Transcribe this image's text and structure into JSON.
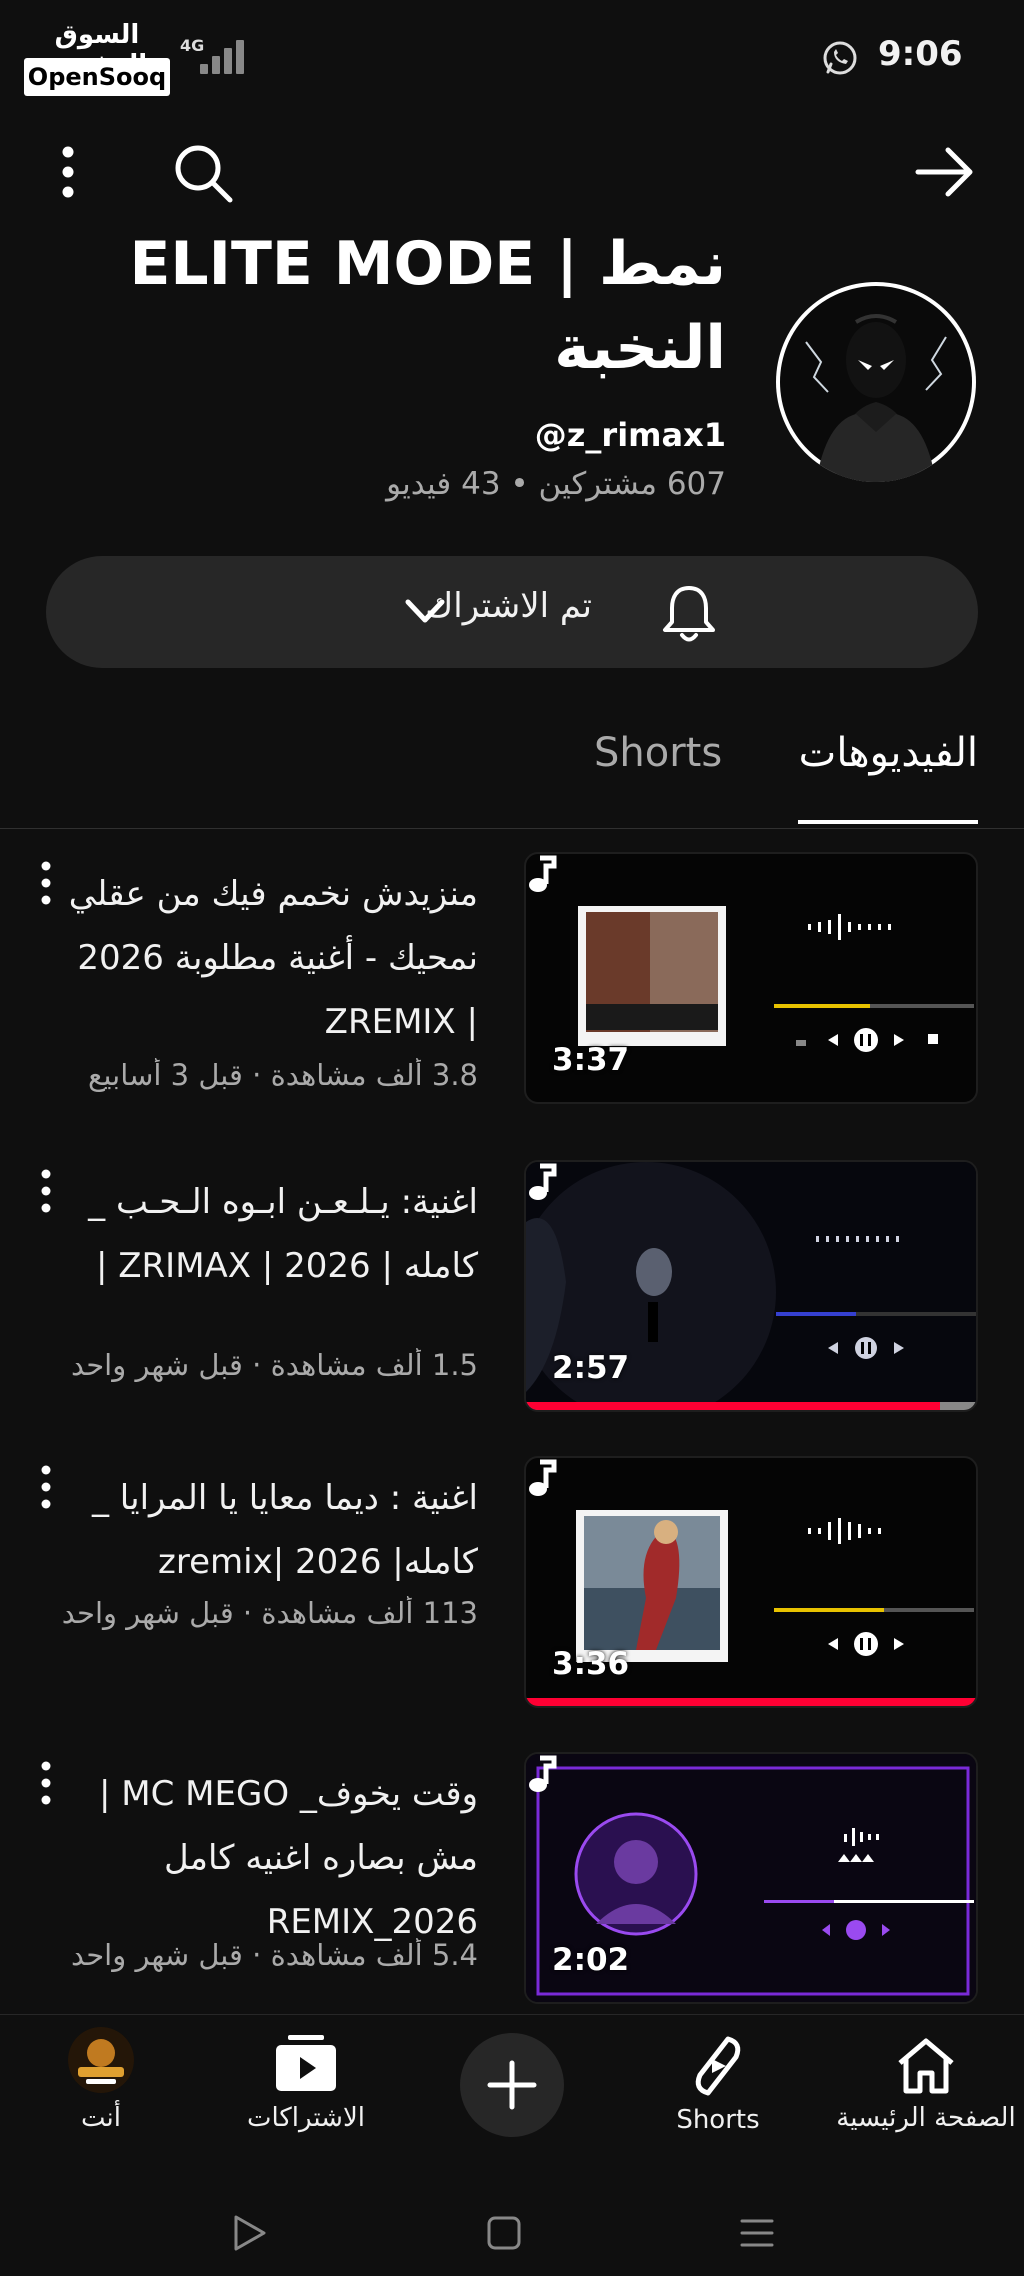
{
  "status_bar": {
    "watermark_ar": "السوق المفتوح",
    "watermark_en": "OpenSooq",
    "network": "4G",
    "time": "9:06"
  },
  "channel": {
    "title": "ELITE MODE | نمط النخبة",
    "handle": "@z_rimax1",
    "stats": "607 مشتركين • 43 فيديو",
    "subscribe_label": "تم الاشتراك"
  },
  "tabs": {
    "videos": "الفيديوهات",
    "shorts": "Shorts"
  },
  "videos": [
    {
      "title": "منزيدش نخمم فيك من عقلي نمحيك  -  أغنية مطلوبة 2026 | ZREMIX",
      "meta": "3.8 ألف مشاهدة · قبل 3 أسابيع",
      "duration": "3:37",
      "watched_fraction": 0
    },
    {
      "title": "اغنية: يـلـعـن ابـوه الـحـب _ كامله | ZRIMAX | 2026 |",
      "meta": "1.5 ألف مشاهدة · قبل شهر واحد",
      "duration": "2:57",
      "watched_fraction": 0.92
    },
    {
      "title": "اغنية : ديما معايا يا المرايا _ كامله| 2026 |zremix",
      "meta": "113 ألف مشاهدة · قبل شهر واحد",
      "duration": "3:36",
      "watched_fraction": 1.0
    },
    {
      "title": "وقت يخوف_ MC MEGO |مش بصاره اغنيه كامل REMIX_2026",
      "meta": "5.4 ألف مشاهدة · قبل شهر واحد",
      "duration": "2:02",
      "watched_fraction": 0
    }
  ],
  "bottom_nav": {
    "home": "الصفحة الرئيسية",
    "shorts": "Shorts",
    "subscriptions": "الاشتراكات",
    "you": "أنت"
  },
  "colors": {
    "background": "#0f0f0f",
    "button_bg": "#272727",
    "progress": "#ff0033",
    "secondary_text": "#aaaaaa"
  }
}
